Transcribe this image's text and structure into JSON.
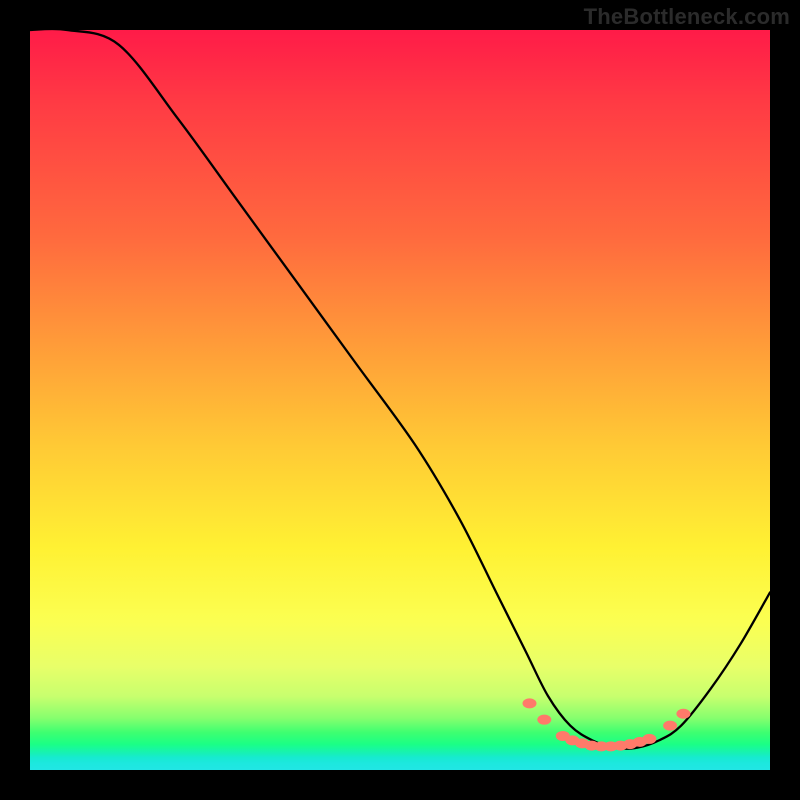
{
  "watermark": "TheBottleneck.com",
  "chart_data": {
    "type": "line",
    "title": "",
    "xlabel": "",
    "ylabel": "",
    "x_range": [
      0,
      100
    ],
    "y_range": [
      0,
      100
    ],
    "curve": {
      "name": "bottleneck-curve",
      "x": [
        0,
        5,
        12,
        20,
        28,
        36,
        44,
        52,
        58,
        63,
        67,
        70,
        73,
        76,
        79,
        82,
        85,
        88,
        92,
        96,
        100
      ],
      "y": [
        100,
        100,
        98,
        88,
        77,
        66,
        55,
        44,
        34,
        24,
        16,
        10,
        6,
        4,
        3,
        3,
        4,
        6,
        11,
        17,
        24
      ]
    },
    "markers": {
      "name": "highlight-dots",
      "color": "#ff7a6a",
      "points": [
        {
          "x": 67.5,
          "y": 9.0
        },
        {
          "x": 69.5,
          "y": 6.8
        },
        {
          "x": 72.0,
          "y": 4.6
        },
        {
          "x": 73.3,
          "y": 4.0
        },
        {
          "x": 74.6,
          "y": 3.6
        },
        {
          "x": 75.9,
          "y": 3.3
        },
        {
          "x": 77.2,
          "y": 3.2
        },
        {
          "x": 78.5,
          "y": 3.2
        },
        {
          "x": 79.8,
          "y": 3.3
        },
        {
          "x": 81.1,
          "y": 3.5
        },
        {
          "x": 82.4,
          "y": 3.8
        },
        {
          "x": 83.7,
          "y": 4.2
        },
        {
          "x": 86.5,
          "y": 6.0
        },
        {
          "x": 88.3,
          "y": 7.6
        }
      ]
    },
    "gradient_stops": [
      {
        "pos": 0.0,
        "color": "#ff1b48"
      },
      {
        "pos": 0.5,
        "color": "#ffc935"
      },
      {
        "pos": 0.8,
        "color": "#fbff52"
      },
      {
        "pos": 0.95,
        "color": "#3cff71"
      },
      {
        "pos": 1.0,
        "color": "#22e6e4"
      }
    ]
  }
}
